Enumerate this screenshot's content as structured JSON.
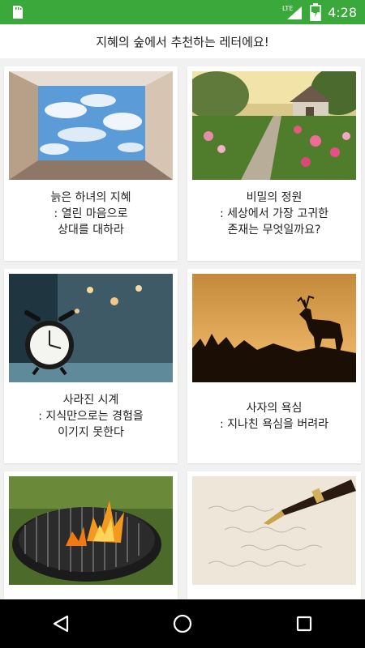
{
  "status_bar": {
    "time": "4:28",
    "network": "LTE",
    "icons": [
      "sdcard-icon",
      "signal-icon",
      "battery-icon"
    ]
  },
  "header": {
    "title": "지혜의 숲에서 추천하는 레터에요!"
  },
  "cards": [
    {
      "line1": "늙은 하녀의 지혜",
      "line2": ": 열린 마음으로",
      "line3": "상대를 대하라",
      "image": "sky-box-image"
    },
    {
      "line1": "비밀의 정원",
      "line2": ": 세상에서 가장 고귀한",
      "line3": "존재는 무엇일까요?",
      "image": "garden-image"
    },
    {
      "line1": "사라진 시계",
      "line2": ": 지식만으로는 경험을",
      "line3": "이기지 못한다",
      "image": "alarm-clock-image"
    },
    {
      "line1": "사자의 욕심",
      "line2": ": 지나친 욕심을 버려라",
      "line3": "",
      "image": "deer-silhouette-image"
    },
    {
      "line1": "",
      "line2": "",
      "line3": "",
      "image": "grill-fire-image"
    },
    {
      "line1": "",
      "line2": "",
      "line3": "",
      "image": "fountain-pen-image"
    }
  ],
  "nav_bar": {
    "buttons": [
      "back-button",
      "home-button",
      "recents-button"
    ]
  },
  "colors": {
    "status_bar": "#3aa83a",
    "nav_bar": "#000000",
    "background": "#f1f1f1"
  }
}
